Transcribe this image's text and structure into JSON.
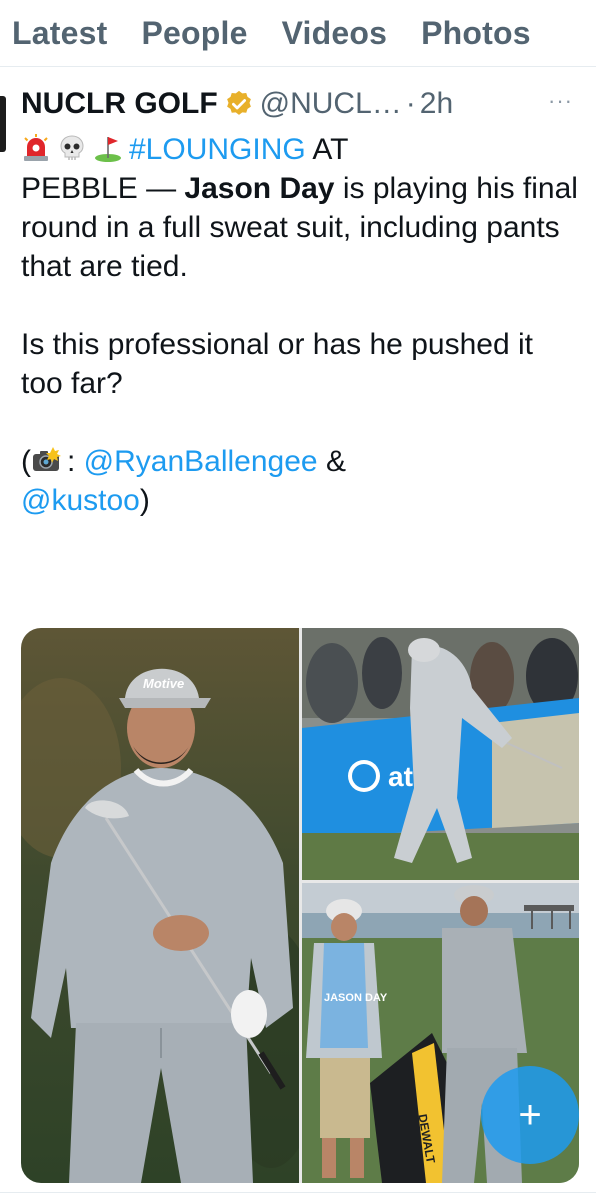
{
  "tabs": [
    "Latest",
    "People",
    "Videos",
    "Photos"
  ],
  "tweet": {
    "author_name": "NUCLR GOLF",
    "handle": "@NUCL…",
    "separator": "·",
    "time": "2h",
    "more_label": "···",
    "hashtag": "#LOUNGING",
    "text_at": " AT",
    "text_pebble": "PEBBLE — ",
    "bold_name": "Jason Day",
    "text_rest": " is playing his final round in a full sweat suit, including pants that are tied.",
    "question": "Is this professional or has he pushed it too far?",
    "credit_open": "(",
    "credit_colon": ": ",
    "mention1": "@RyanBallengee",
    "credit_amp": " &",
    "mention2": "@kustoo",
    "credit_close": ")",
    "emojis": [
      "rotating-light-emoji",
      "skull-emoji",
      "golf-flag-emoji",
      "camera-flash-emoji"
    ]
  },
  "media": {
    "photo_1_cap_text": "Motive",
    "photo_2_sign_text": "at&t",
    "photo_3_bag_text": "DEWALT",
    "photo_3_bib_text": "JASON DAY"
  },
  "fab": {
    "label": "+"
  },
  "colors": {
    "accent": "#1d9bf0",
    "text": "#0f1419",
    "muted": "#536471"
  }
}
